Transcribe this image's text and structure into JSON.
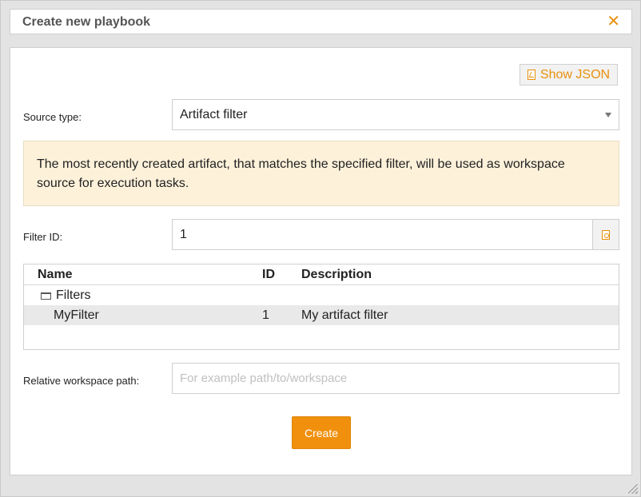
{
  "dialog": {
    "title": "Create new playbook",
    "close_glyph": "✕"
  },
  "toolbar": {
    "show_json_label": "Show JSON",
    "show_json_icon": "json-file-icon"
  },
  "form": {
    "source_type_label": "Source type:",
    "source_type_value": "Artifact filter",
    "notice_text": "The most recently created artifact, that matches the specified filter, will be used as workspace source for execution tasks.",
    "filter_id_label": "Filter ID:",
    "filter_id_value": "1",
    "relative_path_label": "Relative workspace path:",
    "relative_path_value": "",
    "relative_path_placeholder": "For example path/to/workspace",
    "create_label": "Create"
  },
  "table": {
    "headers": [
      "Name",
      "ID",
      "Description"
    ],
    "folder": "Filters",
    "rows": [
      {
        "name": "MyFilter",
        "id": "1",
        "description": "My artifact filter"
      }
    ]
  },
  "colors": {
    "accent": "#f0900d",
    "notice_bg": "#fdf1da",
    "selected_row": "#e9e9e9"
  }
}
